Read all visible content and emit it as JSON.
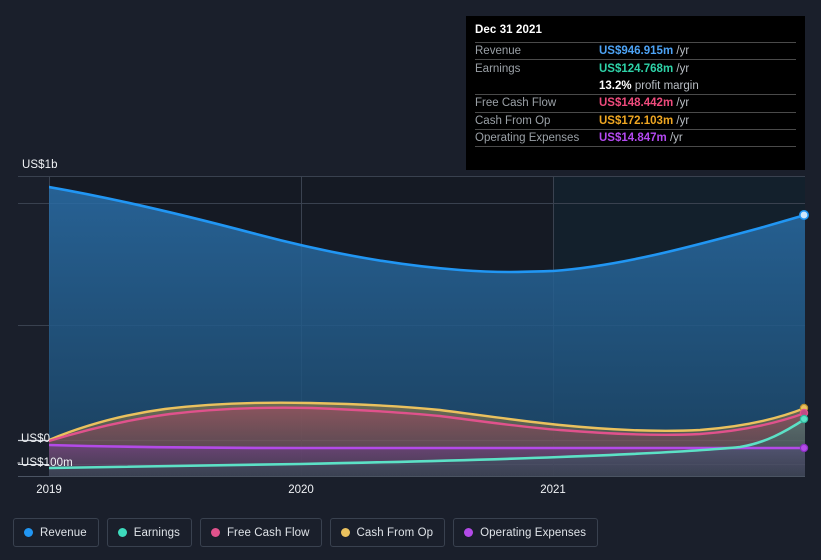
{
  "chart_data": {
    "type": "area",
    "title": "",
    "xlabel": "",
    "ylabel": "",
    "grid": true,
    "legend_position": "bottom",
    "x_ticks": [
      "2019",
      "2020",
      "2021"
    ],
    "y_ticks": [
      "US$1b",
      "US$0",
      "-US$100m"
    ],
    "ylim": [
      -160,
      1130
    ],
    "currency": "US$",
    "series": [
      {
        "name": "Revenue",
        "color": "#2196f3",
        "end_value": 946.915,
        "values": [
          1050,
          1013,
          966,
          915,
          866,
          829,
          806,
          800,
          812,
          842,
          884,
          946.915
        ]
      },
      {
        "name": "Earnings",
        "color": "#5ce1c6",
        "end_value": 124.768,
        "values": [
          -118,
          -114,
          -110,
          -106,
          -101,
          -95,
          -88,
          -80,
          -72,
          -62,
          4,
          124.768
        ]
      },
      {
        "name": "Free Cash Flow",
        "color": "#e0528c",
        "end_value": 148.442,
        "values": [
          2,
          33,
          62,
          85,
          100,
          108,
          110,
          108,
          100,
          92,
          104,
          148.442
        ]
      },
      {
        "name": "Cash From Op",
        "color": "#eac15e",
        "end_value": 172.103,
        "values": [
          4,
          42,
          76,
          101,
          118,
          126,
          128,
          127,
          121,
          113,
          126,
          172.103
        ]
      },
      {
        "name": "Operating Expenses",
        "color": "#b34ae8",
        "end_value": 14.847,
        "values": [
          -18,
          -19,
          -20,
          -20,
          -20,
          -21,
          -21,
          -21,
          -21,
          -21,
          -20,
          14.847
        ]
      }
    ]
  },
  "tooltip": {
    "title": "Dec 31 2021",
    "rows": [
      {
        "key": "Revenue",
        "amount": "US$946.915m",
        "unit": "/yr",
        "color": "#4da3f5"
      },
      {
        "key": "Earnings",
        "amount": "US$124.768m",
        "unit": "/yr",
        "color": "#2ed3a8"
      },
      {
        "key": "Free Cash Flow",
        "amount": "US$148.442m",
        "unit": "/yr",
        "color": "#ef4b7d"
      },
      {
        "key": "Cash From Op",
        "amount": "US$172.103m",
        "unit": "/yr",
        "color": "#f0a722"
      },
      {
        "key": "Operating Expenses",
        "amount": "US$14.847m",
        "unit": "/yr",
        "color": "#b449f0"
      }
    ],
    "profit_margin_value": "13.2%",
    "profit_margin_label": "profit margin"
  },
  "axis": {
    "y_top": "US$1b",
    "y_zero": "US$0",
    "y_neg": "-US$100m",
    "x": [
      "2019",
      "2020",
      "2021"
    ]
  },
  "legend": {
    "items": [
      {
        "label": "Revenue",
        "color": "#2196f3"
      },
      {
        "label": "Earnings",
        "color": "#3ddbbd"
      },
      {
        "label": "Free Cash Flow",
        "color": "#e0528c"
      },
      {
        "label": "Cash From Op",
        "color": "#eac15e"
      },
      {
        "label": "Operating Expenses",
        "color": "#b34ae8"
      }
    ]
  }
}
